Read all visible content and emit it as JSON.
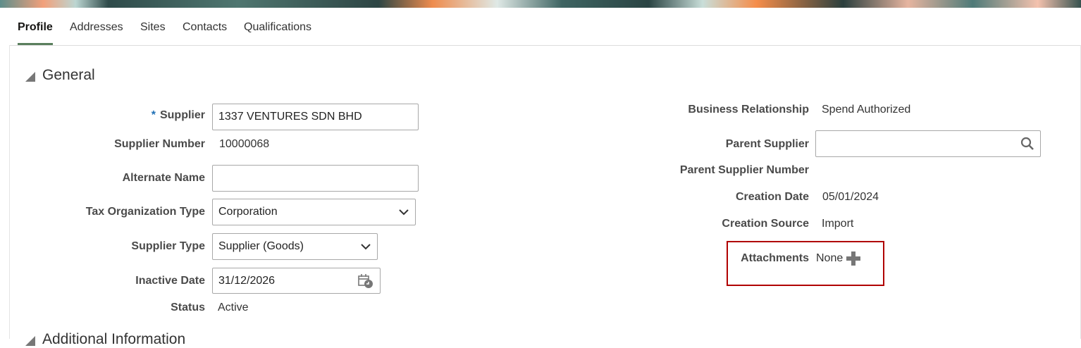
{
  "tabs": [
    "Profile",
    "Addresses",
    "Sites",
    "Contacts",
    "Qualifications"
  ],
  "section": {
    "title": "General",
    "next_title": "Additional Information"
  },
  "left": {
    "supplier_required": "*",
    "supplier_label": "Supplier",
    "supplier_value": "1337 VENTURES SDN BHD",
    "supplier_number_label": "Supplier Number",
    "supplier_number_value": "10000068",
    "alternate_name_label": "Alternate Name",
    "alternate_name_value": "",
    "tax_org_type_label": "Tax Organization Type",
    "tax_org_type_value": "Corporation",
    "supplier_type_label": "Supplier Type",
    "supplier_type_value": "Supplier (Goods)",
    "inactive_date_label": "Inactive Date",
    "inactive_date_value": "31/12/2026",
    "status_label": "Status",
    "status_value": "Active"
  },
  "right": {
    "business_relationship_label": "Business Relationship",
    "business_relationship_value": "Spend Authorized",
    "parent_supplier_label": "Parent Supplier",
    "parent_supplier_value": "",
    "parent_supplier_number_label": "Parent Supplier Number",
    "creation_date_label": "Creation Date",
    "creation_date_value": "05/01/2024",
    "creation_source_label": "Creation Source",
    "creation_source_value": "Import",
    "attachments_label": "Attachments",
    "attachments_value": "None"
  },
  "icons": {
    "collapse": "triangle-icon",
    "dropdown": "chevron-down-icon",
    "calendar": "calendar-icon",
    "search": "search-icon",
    "add": "plus-icon"
  },
  "colors": {
    "active_tab_underline": "#5a7f5d",
    "required_asterisk": "#1f6fb5",
    "highlight_border": "#b00000"
  }
}
